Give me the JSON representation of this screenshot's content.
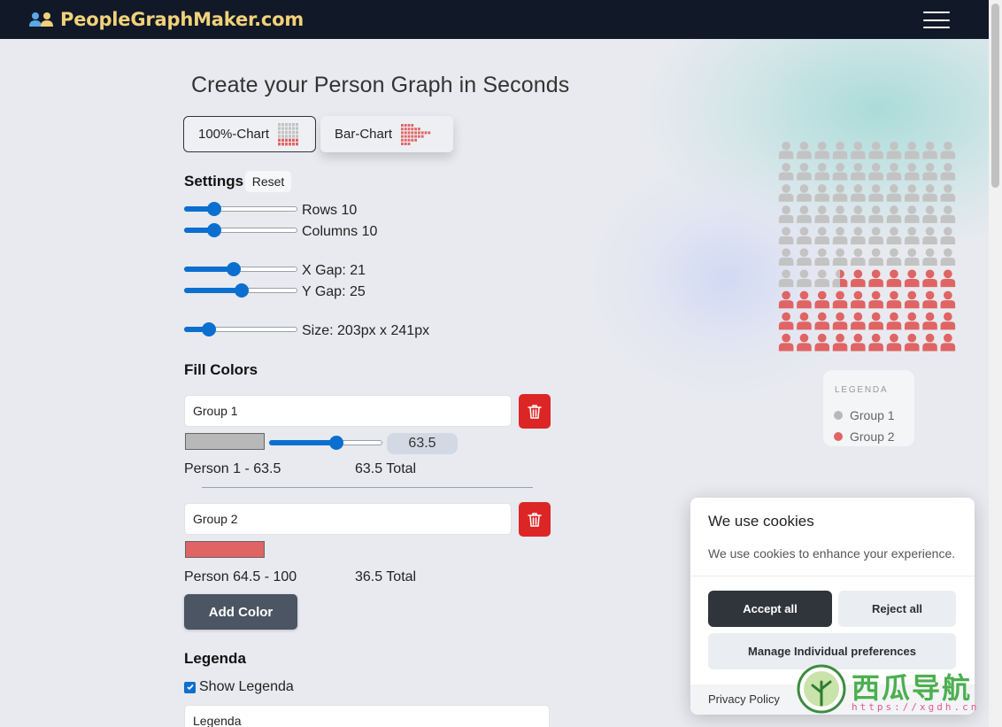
{
  "brand": {
    "name": "PeopleGraphMaker.com",
    "logo_icon": "people-icon",
    "logo_colors": [
      "#5aa9e6",
      "#f1d27a"
    ]
  },
  "page": {
    "title": "Create your Person Graph in Seconds"
  },
  "chart_types": [
    {
      "label": "100%-Chart",
      "icon": "grid-chart-icon",
      "selected": true
    },
    {
      "label": "Bar-Chart",
      "icon": "bar-chart-icon",
      "selected": false
    }
  ],
  "settings": {
    "heading": "Settings",
    "reset_label": "Reset",
    "rows_label": "Rows 10",
    "rows_fraction": 0.23,
    "columns_label": "Columns 10",
    "columns_fraction": 0.23,
    "xgap_label": "X Gap: 21",
    "xgap_fraction": 0.43,
    "ygap_label": "Y Gap: 25",
    "ygap_fraction": 0.51,
    "size_label": "Size: 203px x 241px",
    "size_fraction": 0.18
  },
  "fill_colors": {
    "heading": "Fill Colors",
    "groups": [
      {
        "name": "Group 1",
        "color": "#b8b8b8",
        "value": "63.5",
        "value_fraction": 0.61,
        "range": "Person 1 - 63.5",
        "total": "63.5 Total"
      },
      {
        "name": "Group 2",
        "color": "#e06464",
        "range": "Person 64.5 - 100",
        "total": "36.5 Total"
      }
    ],
    "add_label": "Add Color"
  },
  "legenda": {
    "heading": "Legenda",
    "show_label": "Show Legenda",
    "show_checked": true,
    "title_value": "Legenda"
  },
  "graph": {
    "rows": 10,
    "columns": 10,
    "group1_count": 63.5,
    "colors": {
      "group1": "#c3c3c3",
      "group2": "#e06464"
    },
    "legend_title": "LEGENDA",
    "legend_items": [
      {
        "name": "Group 1",
        "color": "#b8b8b8"
      },
      {
        "name": "Group 2",
        "color": "#e06464"
      }
    ]
  },
  "cookie": {
    "title": "We use cookies",
    "description": "We use cookies to enhance your experience.",
    "accept_label": "Accept all",
    "reject_label": "Reject all",
    "manage_label": "Manage Individual preferences",
    "privacy_label": "Privacy Policy"
  },
  "watermark": {
    "text": "西瓜导航",
    "url": "https://xgdh.cn"
  }
}
